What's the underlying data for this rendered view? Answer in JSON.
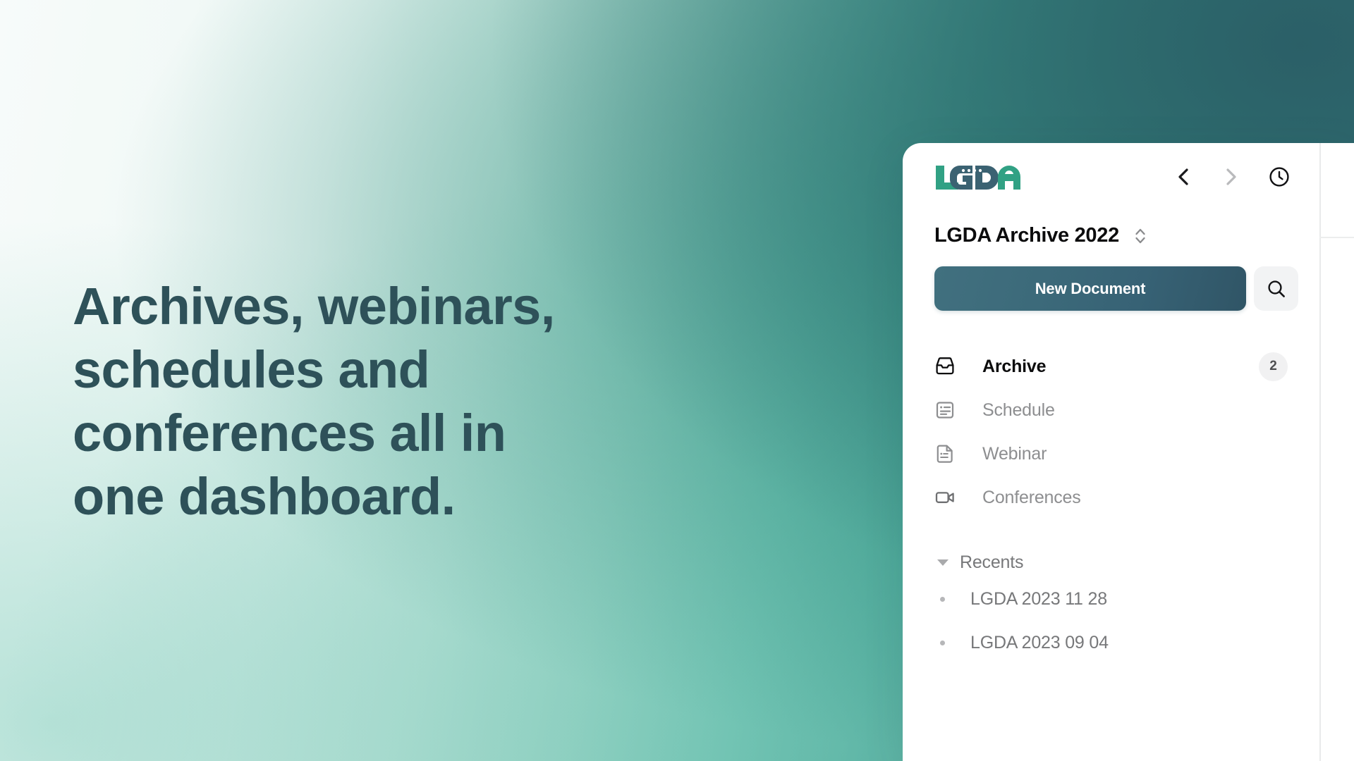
{
  "hero": {
    "headline": "Archives, webinars,\nschedules and\nconferences all in\none dashboard.",
    "headline_color": "#2e5159"
  },
  "colors": {
    "brand_green": "#31a184",
    "brand_slate": "#3b6272",
    "button_gradient_from": "#41707f",
    "button_gradient_to": "#305566",
    "gradient_light": "#f7fbfa",
    "gradient_dark": "#376874"
  },
  "panel": {
    "topbar": {
      "logo_text": "LGDA",
      "back_label": "back-chevron",
      "forward_label": "forward-chevron",
      "history_label": "history-clock"
    },
    "title": {
      "text": "LGDA Archive 2022",
      "stepper_label": "up-down-stepper"
    },
    "actions": {
      "new_document_label": "New Document",
      "search_label": "search-icon"
    },
    "nav": [
      {
        "label": "Archive",
        "icon": "inbox-icon",
        "badge": "2",
        "active": true
      },
      {
        "label": "Schedule",
        "icon": "schedule-icon",
        "badge": "",
        "active": false
      },
      {
        "label": "Webinar",
        "icon": "file-icon",
        "badge": "",
        "active": false
      },
      {
        "label": "Conferences",
        "icon": "video-camera-icon",
        "badge": "",
        "active": false
      }
    ],
    "recents": {
      "title": "Recents",
      "items": [
        {
          "label": "LGDA 2023 11 28"
        },
        {
          "label": "LGDA 2023 09 04"
        }
      ]
    }
  }
}
